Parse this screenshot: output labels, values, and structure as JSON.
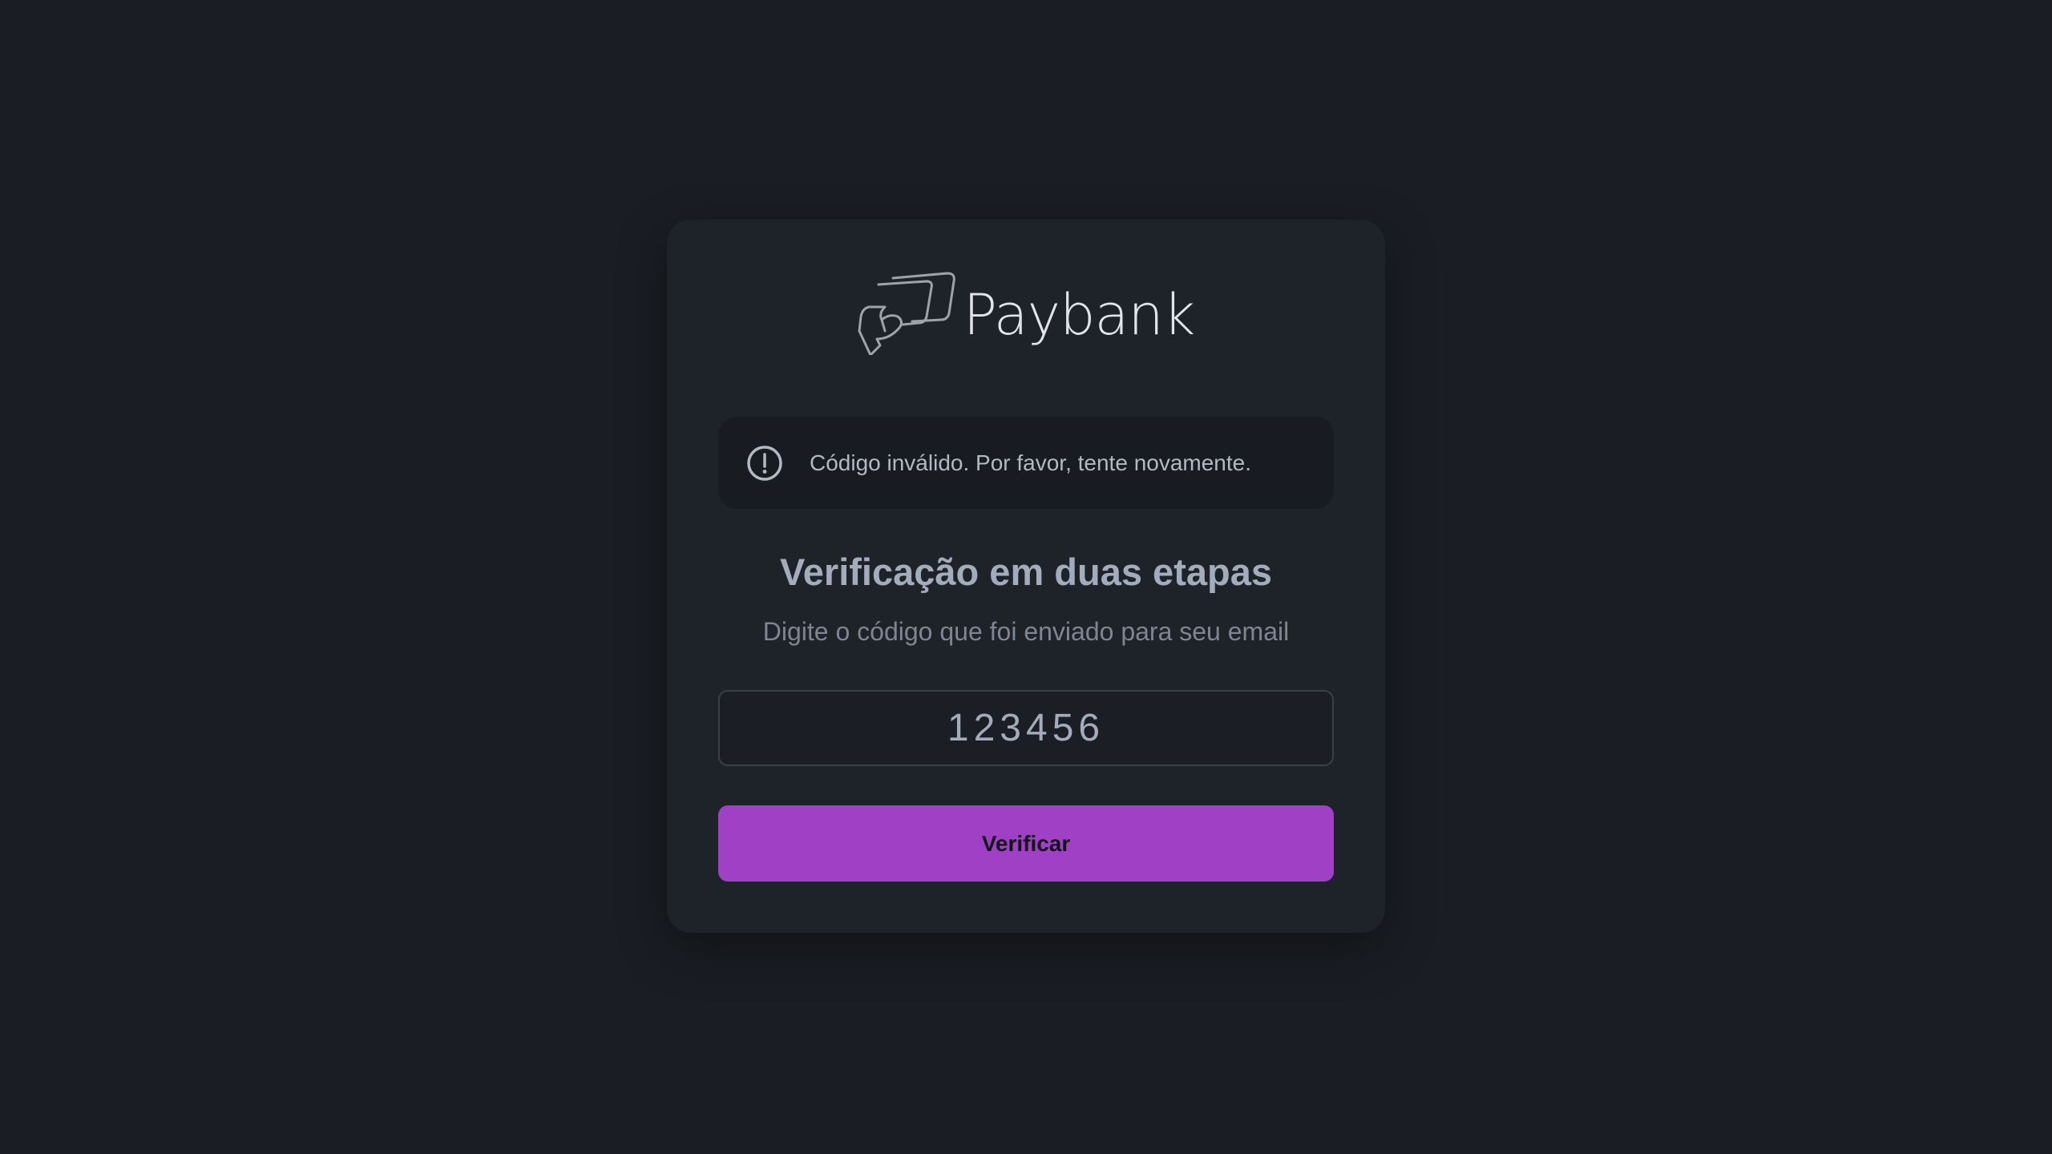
{
  "logo": {
    "text": "Paybank",
    "icon": "paybank-cards-hand-icon"
  },
  "alert": {
    "icon": "exclamation-circle-icon",
    "message": "Código inválido. Por favor, tente novamente."
  },
  "form": {
    "title": "Verificação em duas etapas",
    "subtitle": "Digite o código que foi enviado para seu email",
    "code_value": "123456",
    "submit_label": "Verificar"
  },
  "colors": {
    "background": "#1a1d23",
    "card": "#1e2229",
    "alert_background": "#181b21",
    "accent": "#a041c5",
    "title": "#a3acba",
    "subtitle": "#7f8693"
  }
}
